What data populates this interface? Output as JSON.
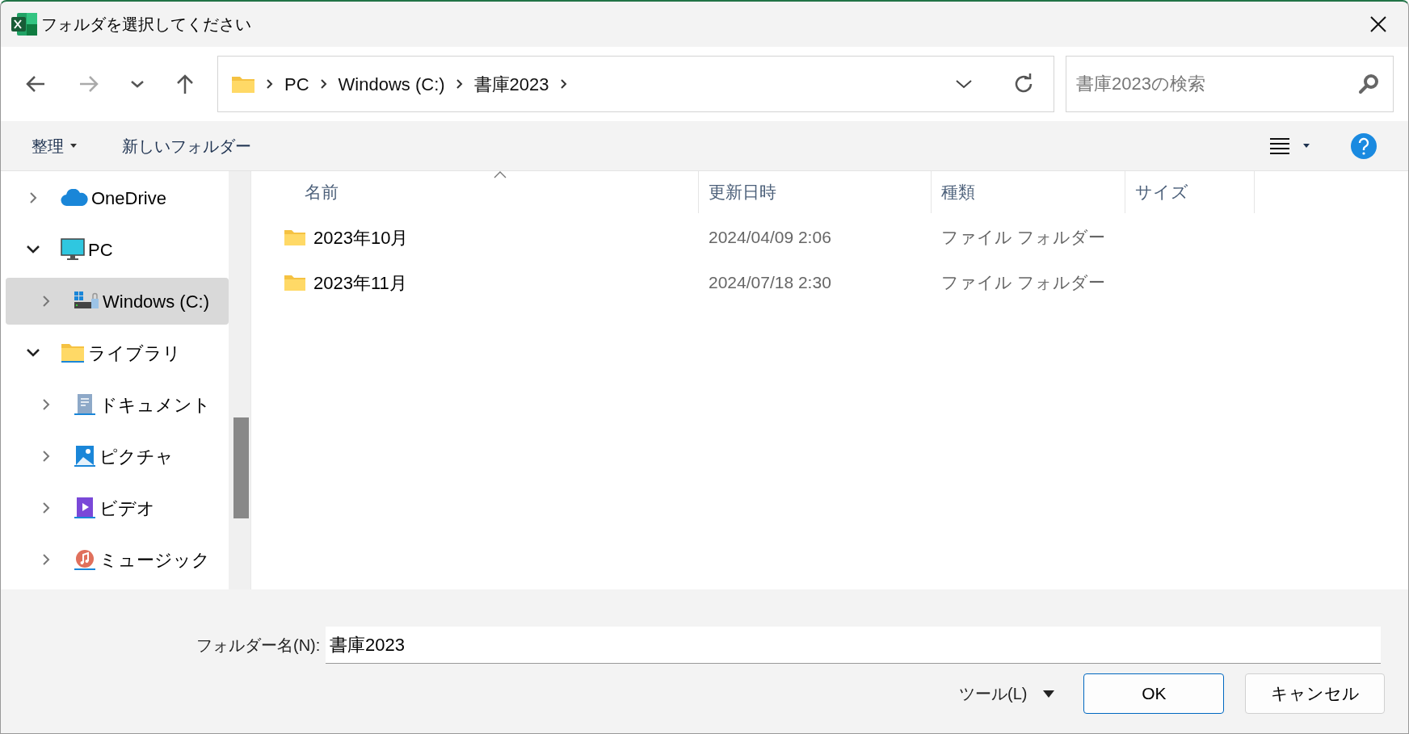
{
  "window": {
    "title": "フォルダを選択してください"
  },
  "breadcrumb": [
    "PC",
    "Windows (C:)",
    "書庫2023"
  ],
  "search": {
    "placeholder": "書庫2023の検索"
  },
  "toolbar": {
    "organize": "整理",
    "new_folder": "新しいフォルダー"
  },
  "sidebar": {
    "items": [
      {
        "label": "OneDrive",
        "kind": "cloud",
        "expanded": false,
        "selected": false
      },
      {
        "label": "PC",
        "kind": "pc",
        "expanded": true,
        "selected": false,
        "children": [
          {
            "label": "Windows (C:)",
            "kind": "drive",
            "expanded": false,
            "selected": true
          }
        ]
      },
      {
        "label": "ライブラリ",
        "kind": "library",
        "expanded": true,
        "selected": false,
        "children": [
          {
            "label": "ドキュメント",
            "kind": "documents",
            "expanded": false,
            "selected": false
          },
          {
            "label": "ピクチャ",
            "kind": "pictures",
            "expanded": false,
            "selected": false
          },
          {
            "label": "ビデオ",
            "kind": "videos",
            "expanded": false,
            "selected": false
          },
          {
            "label": "ミュージック",
            "kind": "music",
            "expanded": false,
            "selected": false
          }
        ]
      }
    ]
  },
  "table": {
    "columns": [
      "名前",
      "更新日時",
      "種類",
      "サイズ"
    ],
    "rows": [
      {
        "name": "2023年10月",
        "modified": "2024/04/09 2:06",
        "type": "ファイル フォルダー"
      },
      {
        "name": "2023年11月",
        "modified": "2024/07/18 2:30",
        "type": "ファイル フォルダー"
      }
    ]
  },
  "folder_name": {
    "label": "フォルダー名(N):",
    "value": "書庫2023"
  },
  "buttons": {
    "tools": "ツール(L)",
    "ok": "OK",
    "cancel": "キャンセル"
  }
}
